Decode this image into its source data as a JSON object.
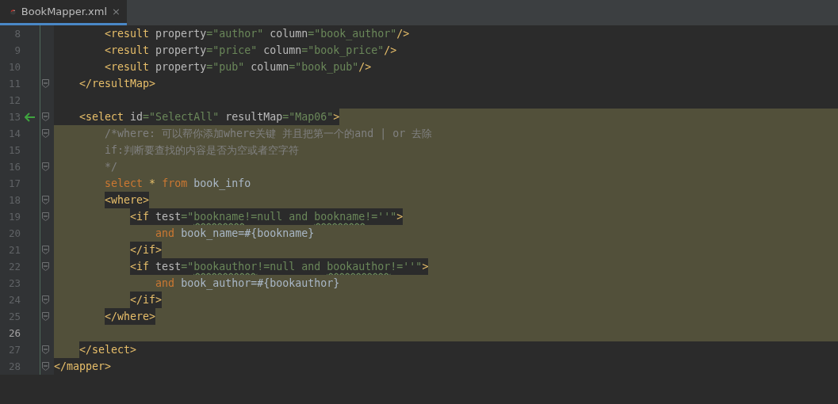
{
  "tab": {
    "title": "BookMapper.xml",
    "close": "×",
    "selected": true
  },
  "lines": [
    {
      "number": "8",
      "selected": false,
      "fold": false,
      "tokens": [
        {
          "kind": "tag",
          "text": "        <result"
        },
        {
          "kind": "attr",
          "text": " property"
        },
        {
          "kind": "value",
          "text": "=\"author\""
        },
        {
          "kind": "attr",
          "text": " column"
        },
        {
          "kind": "value",
          "text": "=\"book_author\""
        },
        {
          "kind": "tag",
          "text": "/>"
        }
      ]
    },
    {
      "number": "9",
      "selected": false,
      "fold": false,
      "tokens": [
        {
          "kind": "tag",
          "text": "        <result"
        },
        {
          "kind": "attr",
          "text": " property"
        },
        {
          "kind": "value",
          "text": "=\"price\""
        },
        {
          "kind": "attr",
          "text": " column"
        },
        {
          "kind": "value",
          "text": "=\"book_price\""
        },
        {
          "kind": "tag",
          "text": "/>"
        }
      ]
    },
    {
      "number": "10",
      "selected": false,
      "fold": false,
      "tokens": [
        {
          "kind": "tag",
          "text": "        <result"
        },
        {
          "kind": "attr",
          "text": " property"
        },
        {
          "kind": "value",
          "text": "=\"pub\""
        },
        {
          "kind": "attr",
          "text": " column"
        },
        {
          "kind": "value",
          "text": "=\"book_pub\""
        },
        {
          "kind": "tag",
          "text": "/>"
        }
      ]
    },
    {
      "number": "11",
      "selected": false,
      "fold": true,
      "tokens": [
        {
          "kind": "tag",
          "text": "    </resultMap>"
        }
      ]
    },
    {
      "number": "12",
      "selected": false,
      "fold": false
    },
    {
      "number": "13",
      "selected": true,
      "selection_start": true,
      "fold": true,
      "arrow": true,
      "tokens": [
        {
          "kind": "tag",
          "text": "    <select"
        },
        {
          "kind": "attr",
          "text": " id"
        },
        {
          "kind": "value",
          "text": "=\"SelectAll\""
        },
        {
          "kind": "attr",
          "text": " resultMap"
        },
        {
          "kind": "value",
          "text": "=\"Map06\""
        },
        {
          "kind": "tag",
          "text": ">"
        }
      ]
    },
    {
      "number": "14",
      "selected": true,
      "fold": true,
      "tokens": [
        {
          "kind": "comment",
          "text": "        /*where: 可以帮你添加where关键 并且把第一个的and | or 去除"
        }
      ]
    },
    {
      "number": "15",
      "selected": true,
      "fold": false,
      "tokens": [
        {
          "kind": "comment",
          "text": "        if:判断要查找的内容是否为空或者空字符"
        }
      ]
    },
    {
      "number": "16",
      "selected": true,
      "fold": true,
      "tokens": [
        {
          "kind": "comment",
          "text": "        */"
        }
      ]
    },
    {
      "number": "17",
      "selected": true,
      "fold": false,
      "tokens": [
        {
          "kind": "keyword",
          "text": "        select"
        },
        {
          "kind": "tag",
          "text": " * "
        },
        {
          "kind": "keyword",
          "text": "from"
        },
        {
          "kind": "plain",
          "text": " book_info"
        }
      ]
    },
    {
      "number": "18",
      "selected": true,
      "fold": true,
      "boxed": true,
      "tokens": [
        {
          "kind": "tag",
          "text": "        <where>"
        }
      ]
    },
    {
      "number": "19",
      "selected": true,
      "fold": true,
      "boxed": true,
      "tokens": [
        {
          "kind": "tag",
          "text": "            <if"
        },
        {
          "kind": "attr",
          "text": " test"
        },
        {
          "kind": "value",
          "text": "=\""
        },
        {
          "kind": "value",
          "text": "bookname",
          "typo": true
        },
        {
          "kind": "value",
          "text": "!=null and "
        },
        {
          "kind": "value",
          "text": "bookname",
          "typo": true
        },
        {
          "kind": "value",
          "text": "!=''\""
        },
        {
          "kind": "tag",
          "text": ">"
        }
      ]
    },
    {
      "number": "20",
      "selected": true,
      "fold": false,
      "tokens": [
        {
          "kind": "keyword",
          "text": "                and"
        },
        {
          "kind": "plain",
          "text": " book_name=#{bookname}"
        }
      ]
    },
    {
      "number": "21",
      "selected": true,
      "fold": true,
      "boxed": true,
      "tokens": [
        {
          "kind": "tag",
          "text": "            </if>"
        }
      ]
    },
    {
      "number": "22",
      "selected": true,
      "fold": true,
      "boxed": true,
      "tokens": [
        {
          "kind": "tag",
          "text": "            <if"
        },
        {
          "kind": "attr",
          "text": " test"
        },
        {
          "kind": "value",
          "text": "=\""
        },
        {
          "kind": "value",
          "text": "bookauthor",
          "typo": true
        },
        {
          "kind": "value",
          "text": "!=null and "
        },
        {
          "kind": "value",
          "text": "bookauthor",
          "typo": true
        },
        {
          "kind": "value",
          "text": "!=''\""
        },
        {
          "kind": "tag",
          "text": ">"
        }
      ]
    },
    {
      "number": "23",
      "selected": true,
      "fold": false,
      "tokens": [
        {
          "kind": "keyword",
          "text": "                and"
        },
        {
          "kind": "plain",
          "text": " book_author=#{bookauthor}"
        }
      ]
    },
    {
      "number": "24",
      "selected": true,
      "fold": true,
      "boxed": true,
      "tokens": [
        {
          "kind": "tag",
          "text": "            </if>"
        }
      ]
    },
    {
      "number": "25",
      "selected": true,
      "fold": true,
      "boxed": true,
      "tokens": [
        {
          "kind": "tag",
          "text": "        </where>"
        }
      ]
    },
    {
      "number": "26",
      "selected": true,
      "fold": false,
      "current": true
    },
    {
      "number": "27",
      "selected": true,
      "selection_end": true,
      "fold": true,
      "tokens": [
        {
          "kind": "tag",
          "text": "    </select>"
        }
      ]
    },
    {
      "number": "28",
      "selected": false,
      "fold": true,
      "tokens": [
        {
          "kind": "tag",
          "text": "</mapper>"
        }
      ]
    }
  ]
}
